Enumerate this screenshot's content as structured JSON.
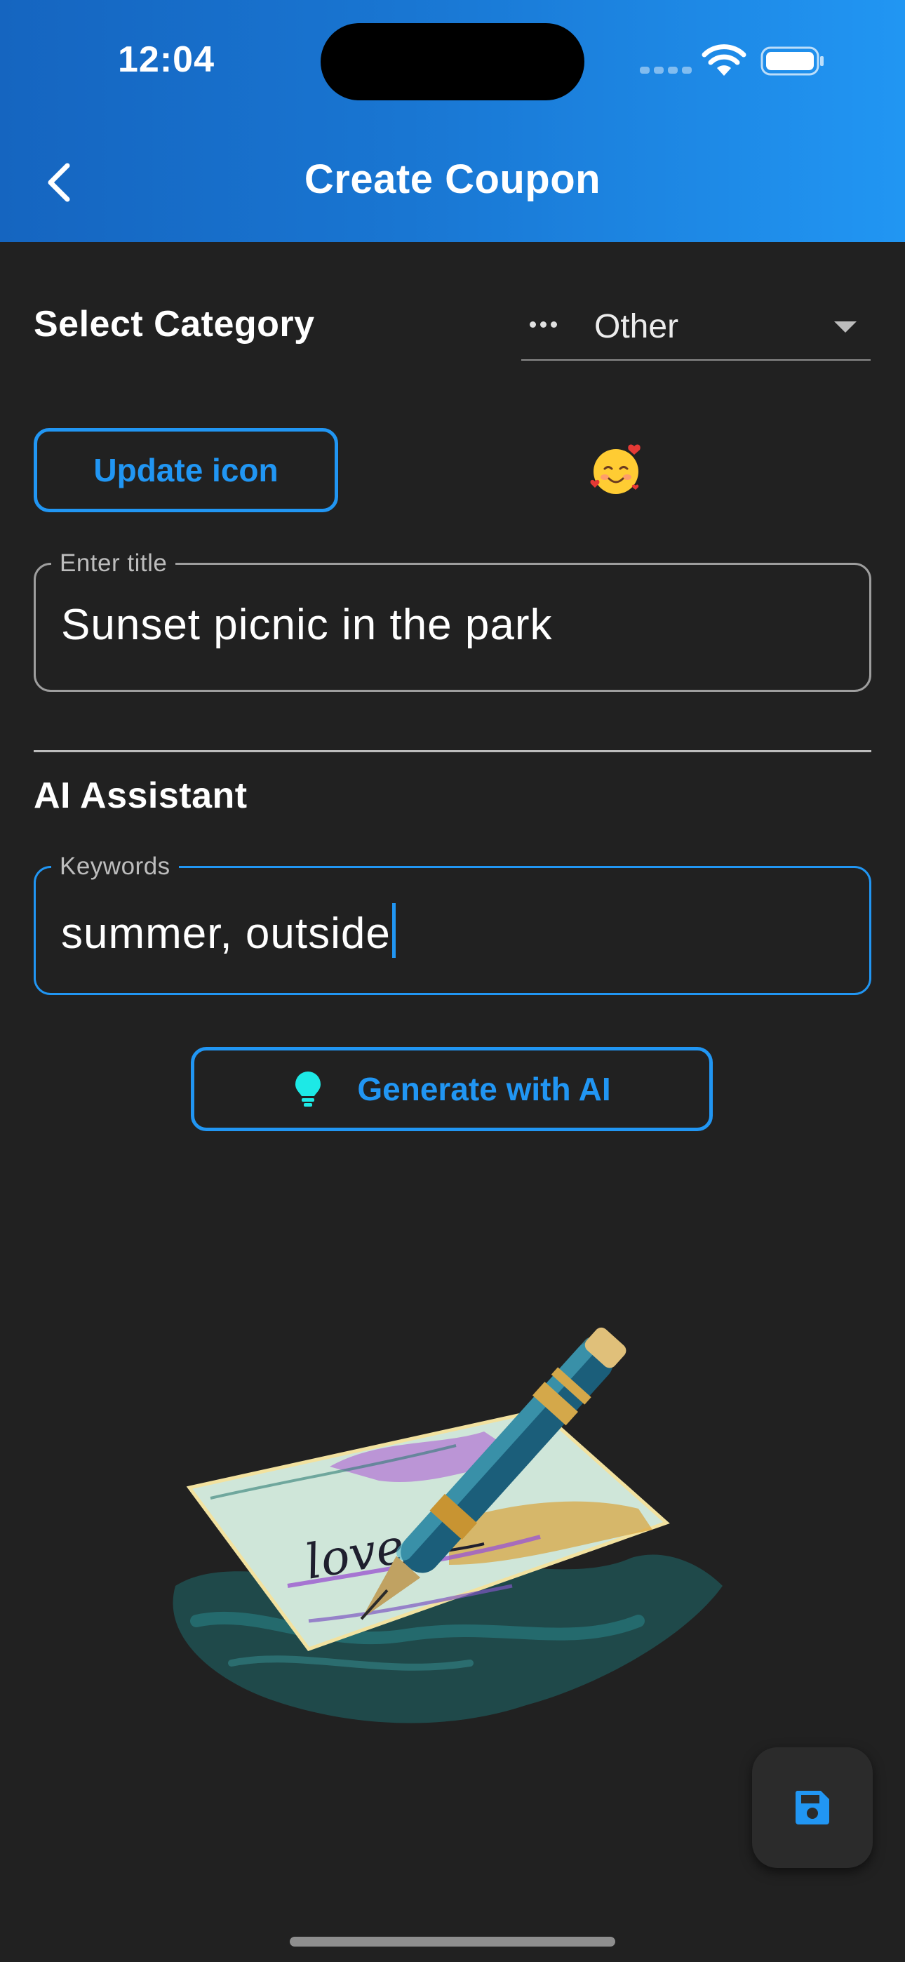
{
  "status_bar": {
    "time": "12:04"
  },
  "header": {
    "title": "Create Coupon"
  },
  "category": {
    "label": "Select Category",
    "selected": "Other",
    "icon": "more-horiz-icon"
  },
  "icon_picker": {
    "button_label": "Update icon",
    "current_icon": "smiling-face-with-hearts-emoji"
  },
  "title_field": {
    "label": "Enter title",
    "value": "Sunset picnic in the park"
  },
  "ai": {
    "section_label": "AI Assistant",
    "keywords_label": "Keywords",
    "keywords_value": "summer, outside",
    "generate_label": "Generate with AI",
    "generate_icon": "lightbulb-icon"
  },
  "preview_image": {
    "subject": "coupon-card-with-fountain-pen-illustration",
    "text_on_card": "love"
  },
  "fab": {
    "icon": "save-icon"
  },
  "colors": {
    "accent": "#2196F3",
    "header_gradient_start": "#1565C0",
    "header_gradient_end": "#2196F3",
    "background": "#212121",
    "bulb": "#1DE9E6"
  }
}
